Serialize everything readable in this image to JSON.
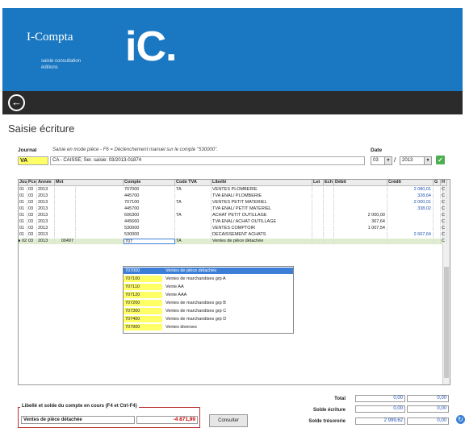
{
  "header": {
    "app_name": "I-Compta",
    "app_sub": "saisie consultation éditions",
    "logo": "iC."
  },
  "nav": {
    "back_icon": "back-arrow-icon"
  },
  "page_title": "Saisie écriture",
  "journal": {
    "label": "Journal",
    "description": "Saisie en mode pièce - F6 = Déclenchement manuel sur le compte \"530000\".",
    "code": "VA",
    "name": "CA - CAISSE; Ser. saisie: 03/2013-01874"
  },
  "date": {
    "label": "Date",
    "month": "03",
    "year": "2013",
    "separator": "/",
    "validate_icon": "check-icon"
  },
  "grid": {
    "columns": [
      "Jour",
      "Pce",
      "Année",
      "Mvt",
      "Compte",
      "Code TVA",
      "Libellé",
      "Let",
      "Ech",
      "Débit",
      "Crédit",
      "G",
      "H"
    ],
    "rows": [
      {
        "jour": "01",
        "pce": "03",
        "annee": "2013",
        "mvt": "",
        "compte": "707000",
        "tva": "TA",
        "libelle": "VENTES PLOMBERIE",
        "debit": "",
        "credit": "2 080,01",
        "g": "",
        "h": "C"
      },
      {
        "jour": "01",
        "pce": "03",
        "annee": "2013",
        "mvt": "",
        "compte": "445700",
        "tva": "",
        "libelle": "TVA ENAL/ PLOMBERIE",
        "debit": "",
        "credit": "328,64",
        "g": "",
        "h": "C"
      },
      {
        "jour": "01",
        "pce": "03",
        "annee": "2013",
        "mvt": "",
        "compte": "707100",
        "tva": "TA",
        "libelle": "VENTES PETIT MATERIEL",
        "debit": "",
        "credit": "2 000,01",
        "g": "",
        "h": "C"
      },
      {
        "jour": "01",
        "pce": "03",
        "annee": "2013",
        "mvt": "",
        "compte": "445700",
        "tva": "",
        "libelle": "TVA ENAL/ PETIT MATERIEL",
        "debit": "",
        "credit": "338,02",
        "g": "",
        "h": "C"
      },
      {
        "jour": "01",
        "pce": "03",
        "annee": "2013",
        "mvt": "",
        "compte": "606300",
        "tva": "TA",
        "libelle": "ACHAT PETIT OUTILLAGE",
        "debit": "2 000,00",
        "credit": "",
        "g": "",
        "h": "C"
      },
      {
        "jour": "01",
        "pce": "03",
        "annee": "2013",
        "mvt": "",
        "compte": "445660",
        "tva": "",
        "libelle": "TVA ENAL/ ACHAT OUTILLAGE",
        "debit": "367,64",
        "credit": "",
        "g": "",
        "h": "C"
      },
      {
        "jour": "01",
        "pce": "03",
        "annee": "2013",
        "mvt": "",
        "compte": "530000",
        "tva": "",
        "libelle": "VENTES COMPTOIR",
        "debit": "1 007,54",
        "credit": "",
        "g": "",
        "h": "C"
      },
      {
        "jour": "01",
        "pce": "03",
        "annee": "2013",
        "mvt": "",
        "compte": "530000",
        "tva": "",
        "libelle": "DECAISSEMENT ACHATS",
        "debit": "",
        "credit": "2 667,64",
        "g": "",
        "h": "C"
      }
    ],
    "active_row": {
      "marker": "▶",
      "jour": "02",
      "pce": "03",
      "annee": "2013",
      "mvt": "00497",
      "compte": "707",
      "tva": "TA",
      "libelle": "Ventes de pièce détachée",
      "debit": "",
      "credit": "",
      "g": "",
      "h": "C"
    }
  },
  "dropdown": {
    "items": [
      {
        "code": "707000",
        "label": "Ventes de pièce détachée"
      },
      {
        "code": "707100",
        "label": "Ventes de marchandises grp A"
      },
      {
        "code": "707110",
        "label": "Vente AA"
      },
      {
        "code": "707120",
        "label": "Vente AAA"
      },
      {
        "code": "707200",
        "label": "Ventes de marchandises grp B"
      },
      {
        "code": "707300",
        "label": "Ventes de marchandises grp C"
      },
      {
        "code": "707400",
        "label": "Ventes de marchandises grp D"
      },
      {
        "code": "707900",
        "label": "Ventes diverses"
      }
    ]
  },
  "account_info": {
    "title": "Libellé et solde du compte en cours (F4 et Ctrl-F4)",
    "name": "Ventes de pièce détachée",
    "amount": "-4 871,99"
  },
  "buttons": {
    "consult": "Consulter"
  },
  "totals": {
    "total_label": "Total",
    "total_debit": "0,00",
    "total_credit": "0,00",
    "solde_ecriture_label": "Solde écriture",
    "solde_ecriture_debit": "0,00",
    "solde_ecriture_credit": "0,00",
    "solde_tresorerie_label": "Solde trésorerie",
    "solde_tresorerie_debit": "2 999,62",
    "solde_tresorerie_credit": "0,00"
  },
  "sync_icon": "sync-icon"
}
